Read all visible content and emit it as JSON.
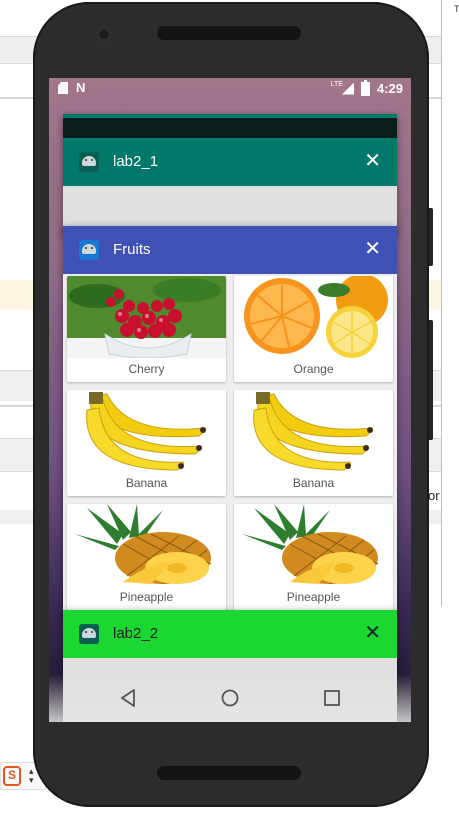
{
  "status_bar": {
    "time": "4:29",
    "network_label": "LTE",
    "icons": [
      "sd-card-icon",
      "n-logo-icon",
      "signal-icon",
      "battery-icon"
    ]
  },
  "recent_apps": [
    {
      "title": "lab2_1",
      "header_color": "#00796b",
      "close_symbol": "✕"
    },
    {
      "title": "Fruits",
      "header_color": "#3f51b5",
      "close_symbol": "✕",
      "items": [
        {
          "name": "Cherry"
        },
        {
          "name": "Orange"
        },
        {
          "name": "Banana"
        },
        {
          "name": "Banana"
        },
        {
          "name": "Pineapple"
        },
        {
          "name": "Pineapple"
        }
      ]
    },
    {
      "title": "lab2_2",
      "header_color": "#1ad831",
      "close_symbol": "✕"
    }
  ],
  "nav_bar": {
    "buttons": [
      "back-icon",
      "home-icon",
      "recents-icon"
    ]
  },
  "background": {
    "side_text": "or"
  }
}
